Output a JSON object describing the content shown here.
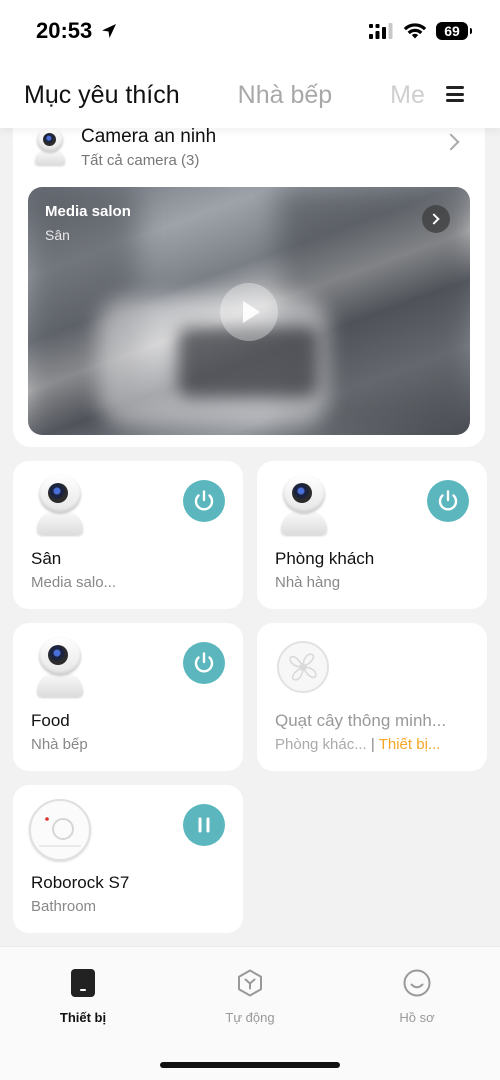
{
  "status_bar": {
    "time": "20:53",
    "battery": "69"
  },
  "header": {
    "tabs": [
      {
        "label": "Mục yêu thích",
        "active": true
      },
      {
        "label": "Nhà bếp",
        "active": false
      },
      {
        "label": "Me",
        "active": false
      }
    ]
  },
  "camera_section": {
    "title": "Camera an ninh",
    "subtitle": "Tất cả camera (3)",
    "video": {
      "title": "Media salon",
      "subtitle": "Sân"
    }
  },
  "devices": [
    {
      "name": "Sân",
      "room": "Media salo...",
      "icon": "camera-icon",
      "action": "power"
    },
    {
      "name": "Phòng khách",
      "room": "Nhà hàng",
      "icon": "camera-icon",
      "action": "power"
    },
    {
      "name": "Food",
      "room": "Nhà bếp",
      "icon": "camera-icon",
      "action": "power"
    },
    {
      "name": "Quạt cây thông minh...",
      "room": "Phòng khác...",
      "room_separator": "|",
      "status": "Thiết bị...",
      "icon": "fan-icon",
      "action": "none"
    },
    {
      "name": "Roborock S7",
      "room": "Bathroom",
      "icon": "robot-vacuum-icon",
      "action": "pause"
    }
  ],
  "bottom_nav": {
    "items": [
      {
        "label": "Thiết bị",
        "active": true,
        "icon": "device-icon"
      },
      {
        "label": "Tự động",
        "active": false,
        "icon": "automation-icon"
      },
      {
        "label": "Hồ sơ",
        "active": false,
        "icon": "profile-icon"
      }
    ]
  },
  "colors": {
    "accent": "#5bb7bd",
    "warning": "#f5a623"
  }
}
